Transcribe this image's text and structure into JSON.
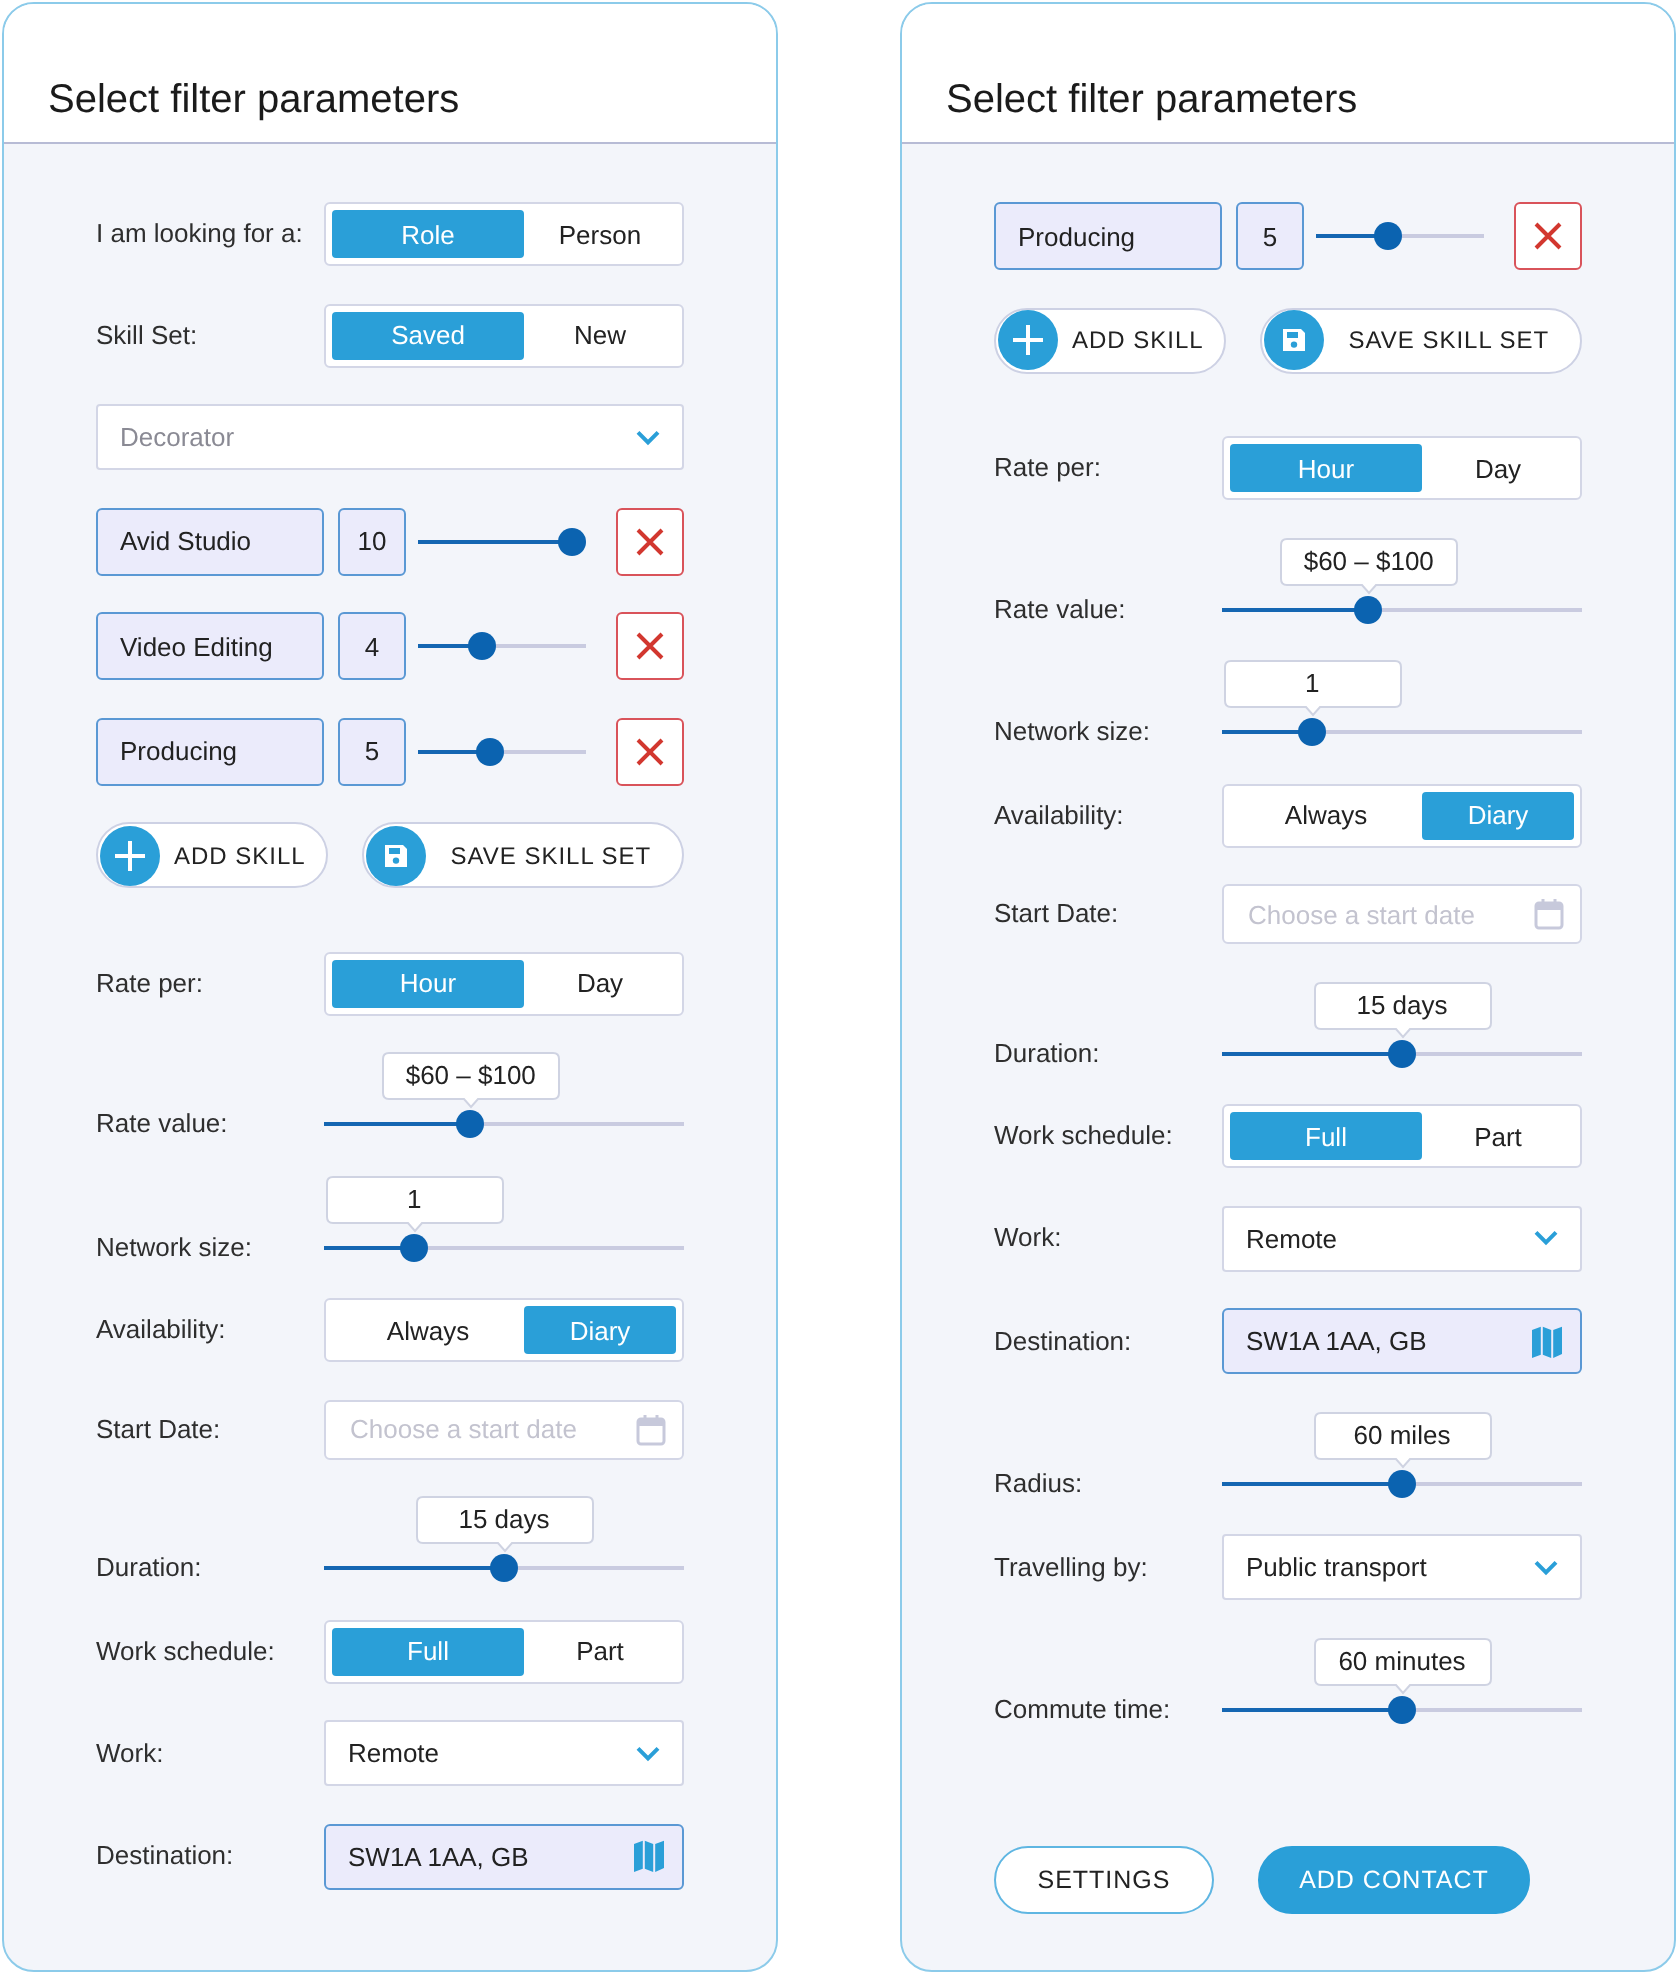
{
  "panels": [
    {
      "title": "Select filter parameters",
      "items": [
        {
          "kind": "segmented",
          "label": "I am looking for a:",
          "options": [
            {
              "label": "Role",
              "selected": true
            },
            {
              "label": "Person",
              "selected": false
            }
          ]
        },
        {
          "kind": "segmented",
          "label": "Skill Set:",
          "options": [
            {
              "label": "Saved",
              "selected": true
            },
            {
              "label": "New",
              "selected": false
            }
          ]
        },
        {
          "kind": "dropdown",
          "placeholder": "Decorator"
        },
        {
          "kind": "skill",
          "name": "Avid Studio",
          "count": "10",
          "level": 1
        },
        {
          "kind": "skill",
          "name": "Video Editing",
          "count": "4",
          "level": 0.35
        },
        {
          "kind": "skill",
          "name": "Producing",
          "count": "5",
          "level": 0.42
        },
        {
          "kind": "actions",
          "buttons": [
            {
              "kind": "add",
              "label": "ADD SKILL"
            },
            {
              "kind": "save",
              "label": "SAVE SKILL SET"
            }
          ]
        },
        {
          "kind": "segmented",
          "label": "Rate per:",
          "options": [
            {
              "label": "Hour",
              "selected": true
            },
            {
              "label": "Day",
              "selected": false
            }
          ]
        },
        {
          "kind": "slider",
          "label": "Rate value:",
          "reading": "$60 – $100",
          "level": 0.4
        },
        {
          "kind": "slider",
          "label": "Network size:",
          "reading": "1",
          "level": 0.23
        },
        {
          "kind": "segmented",
          "label": "Availability:",
          "options": [
            {
              "label": "Always",
              "selected": false
            },
            {
              "label": "Diary",
              "selected": true
            }
          ]
        },
        {
          "kind": "date",
          "label": "Start Date:",
          "placeholder": "Choose a start date"
        },
        {
          "kind": "slider",
          "label": "Duration:",
          "reading": "15 days",
          "level": 0.5
        },
        {
          "kind": "segmented",
          "label": "Work schedule:",
          "options": [
            {
              "label": "Full",
              "selected": true
            },
            {
              "label": "Part",
              "selected": false
            }
          ]
        },
        {
          "kind": "dropdown",
          "label": "Work:",
          "value": "Remote"
        },
        {
          "kind": "location",
          "label": "Destination:",
          "value": "SW1A 1AA, GB"
        }
      ]
    },
    {
      "title": "Select filter parameters",
      "items": [
        {
          "kind": "skill",
          "name": "Producing",
          "count": "5",
          "level": 0.42
        },
        {
          "kind": "actions",
          "buttons": [
            {
              "kind": "add",
              "label": "ADD SKILL"
            },
            {
              "kind": "save",
              "label": "SAVE SKILL SET"
            }
          ]
        },
        {
          "kind": "segmented",
          "label": "Rate per:",
          "options": [
            {
              "label": "Hour",
              "selected": true
            },
            {
              "label": "Day",
              "selected": false
            }
          ]
        },
        {
          "kind": "slider",
          "label": "Rate value:",
          "reading": "$60 – $100",
          "level": 0.4
        },
        {
          "kind": "slider",
          "label": "Network size:",
          "reading": "1",
          "level": 0.23
        },
        {
          "kind": "segmented",
          "label": "Availability:",
          "options": [
            {
              "label": "Always",
              "selected": false
            },
            {
              "label": "Diary",
              "selected": true
            }
          ]
        },
        {
          "kind": "date",
          "label": "Start Date:",
          "placeholder": "Choose a start date"
        },
        {
          "kind": "slider",
          "label": "Duration:",
          "reading": "15 days",
          "level": 0.5
        },
        {
          "kind": "segmented",
          "label": "Work schedule:",
          "options": [
            {
              "label": "Full",
              "selected": true
            },
            {
              "label": "Part",
              "selected": false
            }
          ]
        },
        {
          "kind": "dropdown",
          "label": "Work:",
          "value": "Remote"
        },
        {
          "kind": "location",
          "label": "Destination:",
          "value": "SW1A 1AA, GB"
        },
        {
          "kind": "slider",
          "label": "Radius:",
          "reading": "60 miles",
          "level": 0.5
        },
        {
          "kind": "dropdown",
          "label": "Travelling by:",
          "value": "Public transport"
        },
        {
          "kind": "slider",
          "label": "Commute time:",
          "reading": "60 minutes",
          "level": 0.5
        }
      ],
      "footer": [
        {
          "kind": "outline",
          "label": "SETTINGS"
        },
        {
          "kind": "primary",
          "label": "ADD CONTACT"
        }
      ]
    }
  ]
}
